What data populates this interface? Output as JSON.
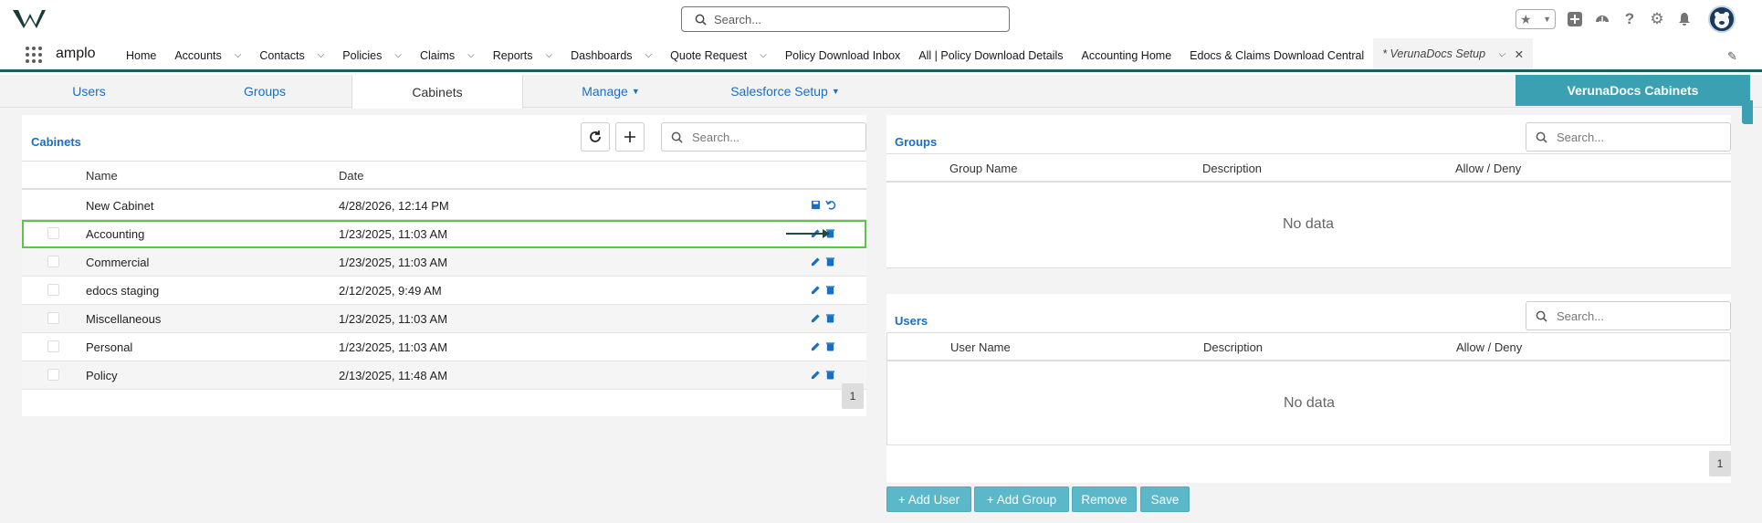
{
  "header": {
    "search_placeholder": "Search...",
    "icons": [
      "star-icon",
      "chevron-down-icon",
      "plus-icon",
      "trailhead-icon",
      "help-icon",
      "gear-icon",
      "bell-icon"
    ]
  },
  "nav": {
    "app_name": "amplo",
    "items": [
      {
        "label": "Home",
        "chevron": false
      },
      {
        "label": "Accounts",
        "chevron": true
      },
      {
        "label": "Contacts",
        "chevron": true
      },
      {
        "label": "Policies",
        "chevron": true
      },
      {
        "label": "Claims",
        "chevron": true
      },
      {
        "label": "Reports",
        "chevron": true
      },
      {
        "label": "Dashboards",
        "chevron": true
      },
      {
        "label": "Quote Request",
        "chevron": true
      },
      {
        "label": "Policy Download Inbox",
        "chevron": false
      },
      {
        "label": "All | Policy Download Details",
        "chevron": false
      },
      {
        "label": "Accounting Home",
        "chevron": false
      },
      {
        "label": "Edocs & Claims Download Central",
        "chevron": false
      }
    ],
    "active_tab": "* VerunaDocs Setup"
  },
  "tabs": {
    "users": "Users",
    "groups": "Groups",
    "cabinets": "Cabinets",
    "manage": "Manage",
    "salesforce_setup": "Salesforce Setup",
    "verunadocs_cabinets": "VerunaDocs Cabinets"
  },
  "cabinets": {
    "title": "Cabinets",
    "search_placeholder": "Search...",
    "columns": {
      "name": "Name",
      "date": "Date"
    },
    "rows": [
      {
        "name": "New Cabinet",
        "date": "4/28/2026, 12:14 PM"
      },
      {
        "name": "Accounting",
        "date": "1/23/2025, 11:03 AM"
      },
      {
        "name": "Commercial",
        "date": "1/23/2025, 11:03 AM"
      },
      {
        "name": "edocs staging",
        "date": "2/12/2025, 9:49 AM"
      },
      {
        "name": "Miscellaneous",
        "date": "1/23/2025, 11:03 AM"
      },
      {
        "name": "Personal",
        "date": "1/23/2025, 11:03 AM"
      },
      {
        "name": "Policy",
        "date": "2/13/2025, 11:48 AM"
      }
    ],
    "page": "1"
  },
  "groups": {
    "title": "Groups",
    "search_placeholder": "Search...",
    "columns": {
      "group_name": "Group Name",
      "description": "Description",
      "allow_deny": "Allow / Deny"
    },
    "empty": "No data"
  },
  "users": {
    "title": "Users",
    "search_placeholder": "Search...",
    "columns": {
      "user_name": "User Name",
      "description": "Description",
      "allow_deny": "Allow / Deny"
    },
    "empty": "No data",
    "page": "1"
  },
  "actions": {
    "add_user": "+ Add User",
    "add_group": "+ Add Group",
    "remove": "Remove",
    "save": "Save"
  },
  "colors": {
    "accent": "#1a6fc4",
    "teal": "#3ba0b1",
    "button": "#5bb8c8",
    "nav_underline": "#1b5f5a",
    "selected_outline": "#5fc24a"
  }
}
